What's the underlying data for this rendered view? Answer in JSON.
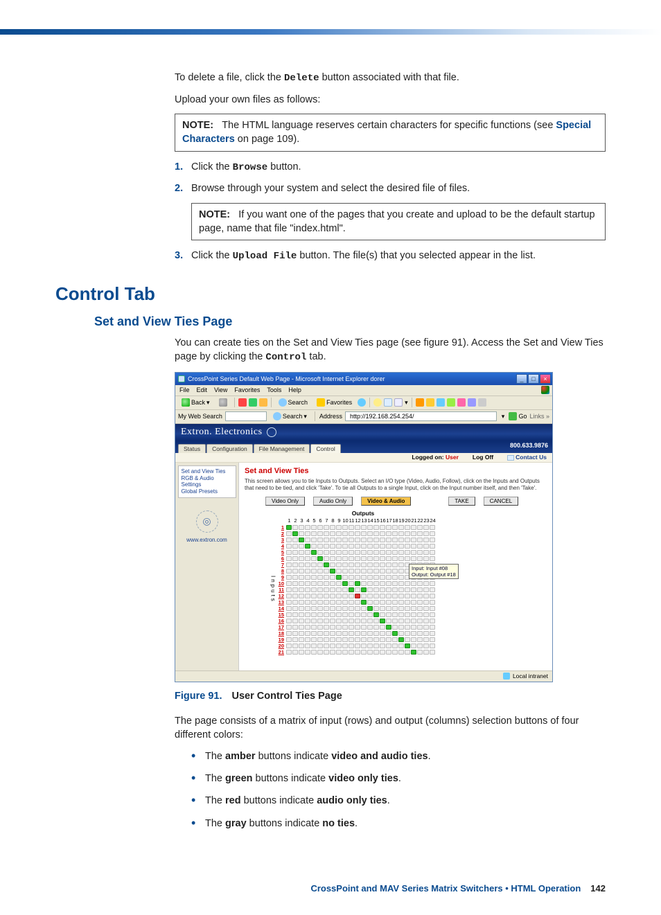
{
  "intro": {
    "p1a": "To delete a file, click the ",
    "p1code": "Delete",
    "p1b": " button associated with that file.",
    "p2": "Upload your own files as follows:"
  },
  "note1": {
    "label": "NOTE:",
    "text_a": "The HTML language reserves certain characters for specific functions (see ",
    "link": "Special Characters",
    "text_b": " on page 109)."
  },
  "steps": {
    "s1": {
      "num": "1.",
      "a": "Click the ",
      "code": "Browse",
      "b": " button."
    },
    "s2": {
      "num": "2.",
      "text": "Browse through your system and select the desired file of files."
    },
    "s3": {
      "num": "3.",
      "a": "Click the ",
      "code": "Upload File",
      "b": " button. The file(s) that you selected appear in the list."
    }
  },
  "note2": {
    "label": "NOTE:",
    "text": "If you want one of the pages that you create and upload to be the default startup page, name that file \"index.html\"."
  },
  "h1": "Control Tab",
  "h2": "Set and View Ties Page",
  "controlPara": {
    "a": "You can create ties on the Set and View Ties page (see figure 91). Access the Set and View Ties page by clicking the ",
    "code": "Control",
    "b": " tab."
  },
  "browser": {
    "title": "CrossPoint Series Default Web Page - Microsoft Internet Explorer dorer",
    "menus": [
      "File",
      "Edit",
      "View",
      "Favorites",
      "Tools",
      "Help"
    ],
    "back": "Back",
    "search": "Search",
    "favorites": "Favorites",
    "mywebsearch": "My Web Search",
    "searchBtn": "Search",
    "addressLbl": "Address",
    "address": "http://192.168.254.254/",
    "go": "Go",
    "links": "Links",
    "status": "Local intranet"
  },
  "page": {
    "brand": "Extron. Electronics",
    "tabs": [
      "Status",
      "Configuration",
      "File Management",
      "Control"
    ],
    "phone": "800.633.9876",
    "loggedon": "Logged on:",
    "user": "User",
    "logoff": "Log Off",
    "contact": "Contact Us",
    "sidebar": {
      "items": [
        "Set and View Ties",
        "RGB & Audio Settings",
        "Global Presets"
      ],
      "url": "www.extron.com"
    },
    "main": {
      "title": "Set and View Ties",
      "desc": "This screen allows you to tie Inputs to Outputs. Select an I/O type (Video, Audio, Follow), click on the Inputs and Outputs that need to be tied, and click 'Take'. To tie all Outputs to a single Input, click on the Input number itself, and then 'Take'.",
      "btns": {
        "video": "Video Only",
        "audio": "Audio Only",
        "va": "Video & Audio",
        "take": "TAKE",
        "cancel": "CANCEL"
      },
      "outputsLabel": "Outputs",
      "inputsLabel": "Inputs",
      "cols": [
        "1",
        "2",
        "3",
        "4",
        "5",
        "6",
        "7",
        "8",
        "9",
        "10",
        "11",
        "12",
        "13",
        "14",
        "15",
        "16",
        "17",
        "18",
        "19",
        "20",
        "21",
        "22",
        "23",
        "24"
      ],
      "rows": [
        "1",
        "2",
        "3",
        "4",
        "5",
        "6",
        "7",
        "8",
        "9",
        "10",
        "11",
        "12",
        "13",
        "14",
        "15",
        "16",
        "17",
        "18",
        "19",
        "20",
        "21"
      ],
      "greenCells": [
        {
          "r": 1,
          "c": 1
        },
        {
          "r": 2,
          "c": 2
        },
        {
          "r": 3,
          "c": 3
        },
        {
          "r": 4,
          "c": 4
        },
        {
          "r": 5,
          "c": 5
        },
        {
          "r": 6,
          "c": 6
        },
        {
          "r": 7,
          "c": 7
        },
        {
          "r": 8,
          "c": 8
        },
        {
          "r": 9,
          "c": 9
        },
        {
          "r": 10,
          "c": 10
        },
        {
          "r": 10,
          "c": 12
        },
        {
          "r": 11,
          "c": 11
        },
        {
          "r": 11,
          "c": 13
        },
        {
          "r": 13,
          "c": 13
        },
        {
          "r": 14,
          "c": 14
        },
        {
          "r": 15,
          "c": 15
        },
        {
          "r": 16,
          "c": 16
        },
        {
          "r": 17,
          "c": 17
        },
        {
          "r": 18,
          "c": 18
        },
        {
          "r": 19,
          "c": 19
        },
        {
          "r": 20,
          "c": 20
        },
        {
          "r": 21,
          "c": 21
        }
      ],
      "redCells": [
        {
          "r": 12,
          "c": 12
        }
      ],
      "tooltip": {
        "line1": "Input: Input #08",
        "line2": "Output: Output #18"
      }
    }
  },
  "figcap": {
    "num": "Figure 91.",
    "title": "User Control Ties Page"
  },
  "afterFig": "The page consists of a matrix of input (rows) and output (columns) selection buttons of four different colors:",
  "bullets": {
    "b1": {
      "a": "The ",
      "c1": "amber",
      "b": " buttons indicate ",
      "c2": "video and audio ties",
      "d": "."
    },
    "b2": {
      "a": "The ",
      "c1": "green",
      "b": " buttons indicate ",
      "c2": "video only ties",
      "d": "."
    },
    "b3": {
      "a": "The ",
      "c1": "red",
      "b": " buttons indicate ",
      "c2": "audio only ties",
      "d": "."
    },
    "b4": {
      "a": "The ",
      "c1": "gray",
      "b": " buttons indicate ",
      "c2": "no ties",
      "d": "."
    }
  },
  "footer": {
    "a": "CrossPoint and MAV Series Matrix Switchers • HTML Operation",
    "b": "142"
  }
}
